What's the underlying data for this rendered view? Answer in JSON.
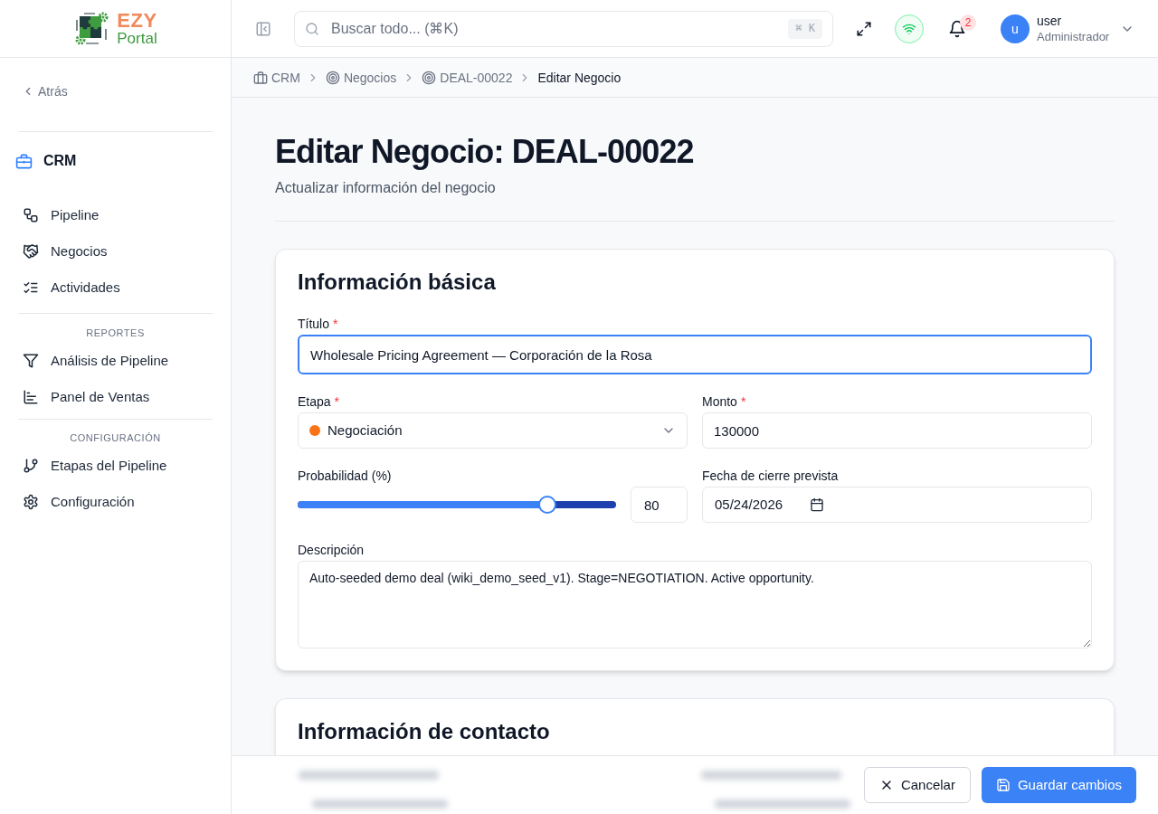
{
  "sidebar": {
    "logo": {
      "title": "EZY",
      "subtitle": "Portal"
    },
    "back": "Atrás",
    "module": "CRM",
    "sections": [
      {
        "items": [
          {
            "label": "Pipeline",
            "selected": false
          },
          {
            "label": "Negocios",
            "selected": false
          },
          {
            "label": "Actividades",
            "selected": false
          }
        ]
      },
      {
        "heading": "REPORTES",
        "items": [
          {
            "label": "Análisis de Pipeline",
            "selected": false
          },
          {
            "label": "Panel de Ventas",
            "selected": false
          }
        ]
      },
      {
        "heading": "CONFIGURACIÓN",
        "items": [
          {
            "label": "Etapas del Pipeline",
            "selected": false
          },
          {
            "label": "Configuración",
            "selected": false
          }
        ]
      }
    ]
  },
  "header": {
    "search": {
      "placeholder": "Buscar todo... (⌘K)",
      "shortcut": "⌘ K"
    },
    "notifications": {
      "count": "2"
    },
    "user": {
      "initial": "u",
      "name": "user",
      "role": "Administrador"
    }
  },
  "breadcrumb": [
    {
      "label": "CRM",
      "current": false
    },
    {
      "label": "Negocios",
      "current": false
    },
    {
      "label": "DEAL-00022",
      "current": false
    },
    {
      "label": "Editar Negocio",
      "current": true
    }
  ],
  "page": {
    "title": "Editar Negocio: DEAL-00022",
    "subtitle": "Actualizar información del negocio"
  },
  "cards": [
    {
      "title": "Información básica",
      "rows": [
        [
          {
            "kind": "text",
            "label": "Título",
            "marker": "*",
            "focused": true,
            "value": "Wholesale Pricing Agreement — Corporación de la Rosa"
          }
        ],
        [
          {
            "kind": "select",
            "label": "Etapa",
            "marker": "*",
            "value": "Negociación",
            "color": "#f97316"
          },
          {
            "kind": "text",
            "label": "Monto",
            "marker": "*",
            "focused": false,
            "value": "130000"
          }
        ],
        [
          {
            "kind": "slider",
            "label": "Probabilidad (%)",
            "level": 0.8,
            "value": "80"
          },
          {
            "kind": "date",
            "label": "Fecha de cierre prevista",
            "value": "05/24/2026"
          }
        ],
        [
          {
            "kind": "textarea",
            "label": "Descripción",
            "value": "Auto-seeded demo deal (wiki_demo_seed_v1). Stage=NEGOTIATION. Active opportunity."
          }
        ]
      ]
    },
    {
      "title": "Información de contacto"
    }
  ],
  "actions": [
    {
      "kind": "secondary",
      "label": "Cancelar"
    },
    {
      "kind": "primary",
      "label": "Guardar cambios"
    }
  ]
}
